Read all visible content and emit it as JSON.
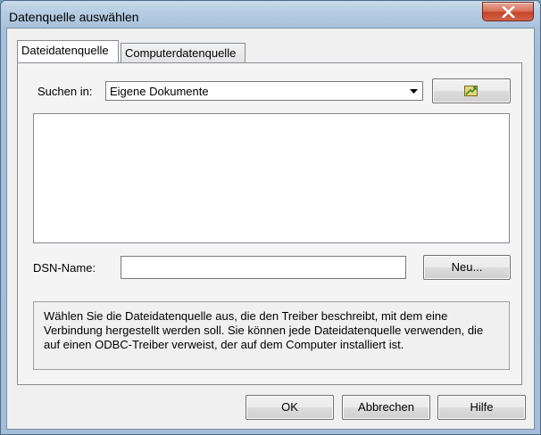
{
  "window": {
    "title": "Datenquelle auswählen"
  },
  "tabs": [
    {
      "label": "Dateidatenquelle",
      "active": true
    },
    {
      "label": "Computerdatenquelle",
      "active": false
    }
  ],
  "lookin": {
    "label": "Suchen in:",
    "value": "Eigene Dokumente"
  },
  "dsn": {
    "label": "DSN-Name:",
    "value": "",
    "new_button": "Neu..."
  },
  "info": {
    "text": "Wählen Sie die Dateidatenquelle aus, die den Treiber beschreibt, mit dem eine Verbindung hergestellt werden soll. Sie können jede Dateidatenquelle verwenden, die auf einen ODBC-Treiber verweist, der auf dem Computer installiert ist."
  },
  "buttons": {
    "ok": "OK",
    "cancel": "Abbrechen",
    "help": "Hilfe"
  },
  "icons": {
    "close": "close-icon",
    "up_folder": "folder-up-icon",
    "dropdown": "chevron-down-icon"
  },
  "colors": {
    "close_button": "#c6452a",
    "frame": "#a9c2dc"
  }
}
